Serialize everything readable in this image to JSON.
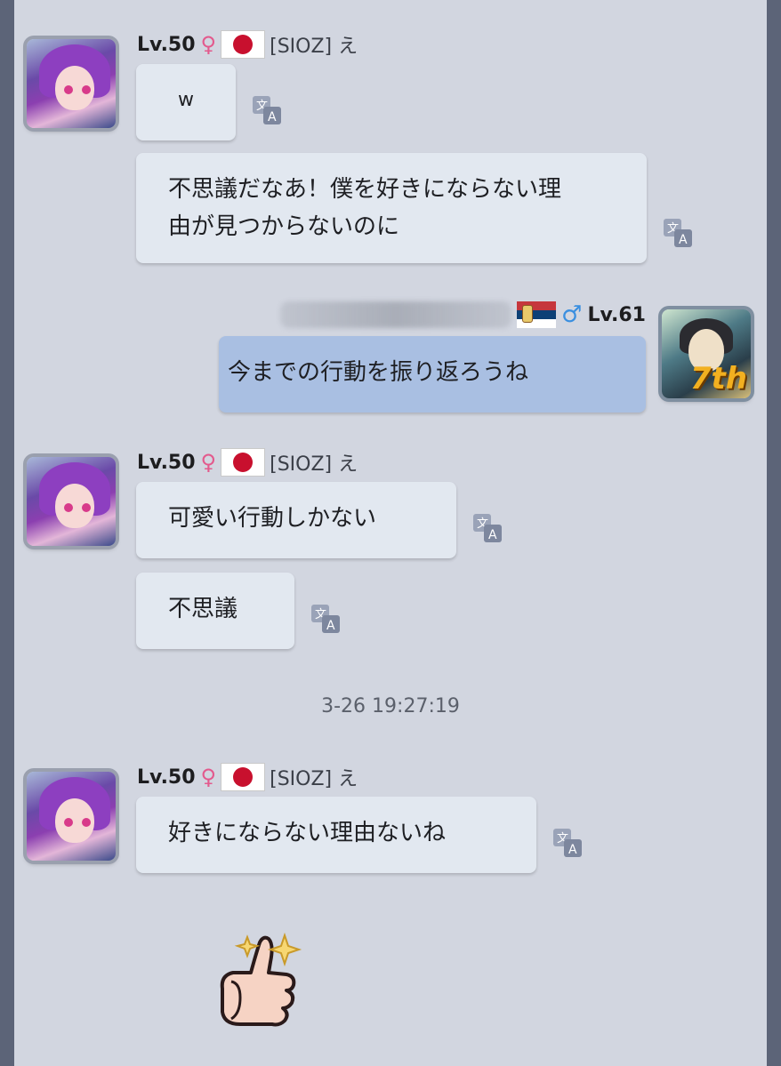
{
  "messages": [
    {
      "sender": {
        "level": "Lv.50",
        "gender_symbol": "♀",
        "flag": "Japan",
        "name": "[SIOZ] え",
        "avatar": "purple-haired-girl-avatar"
      },
      "bubbles": [
        "w",
        "不思議だなあ！僕を好きにならない理\n由が見つからないのに"
      ]
    },
    {
      "sender": {
        "level": "Lv.61",
        "gender_symbol": "♂",
        "flag": "Serbia",
        "name": "",
        "avatar": "7th-anniversary-avatar",
        "badge": "7th"
      },
      "bubbles": [
        "今までの行動を振り返ろうね"
      ]
    },
    {
      "sender": {
        "level": "Lv.50",
        "gender_symbol": "♀",
        "flag": "Japan",
        "name": "[SIOZ] え",
        "avatar": "purple-haired-girl-avatar"
      },
      "bubbles": [
        "可愛い行動しかない",
        "不思議"
      ]
    },
    {
      "timestamp": "3-26 19:27:19"
    },
    {
      "sender": {
        "level": "Lv.50",
        "gender_symbol": "♀",
        "flag": "Japan",
        "name": "[SIOZ] え",
        "avatar": "purple-haired-girl-avatar"
      },
      "bubbles": [
        "好きにならない理由ないね"
      ],
      "sticker": "thumbs-up-sparkle-sticker"
    }
  ],
  "icons": {
    "translate": "translate-icon"
  },
  "colors": {
    "background": "#d2d6e0",
    "bubble_other": "#e2e8f0",
    "bubble_self": "#a9bfe2",
    "female": "#e35a8d",
    "male": "#3a8fe0"
  }
}
